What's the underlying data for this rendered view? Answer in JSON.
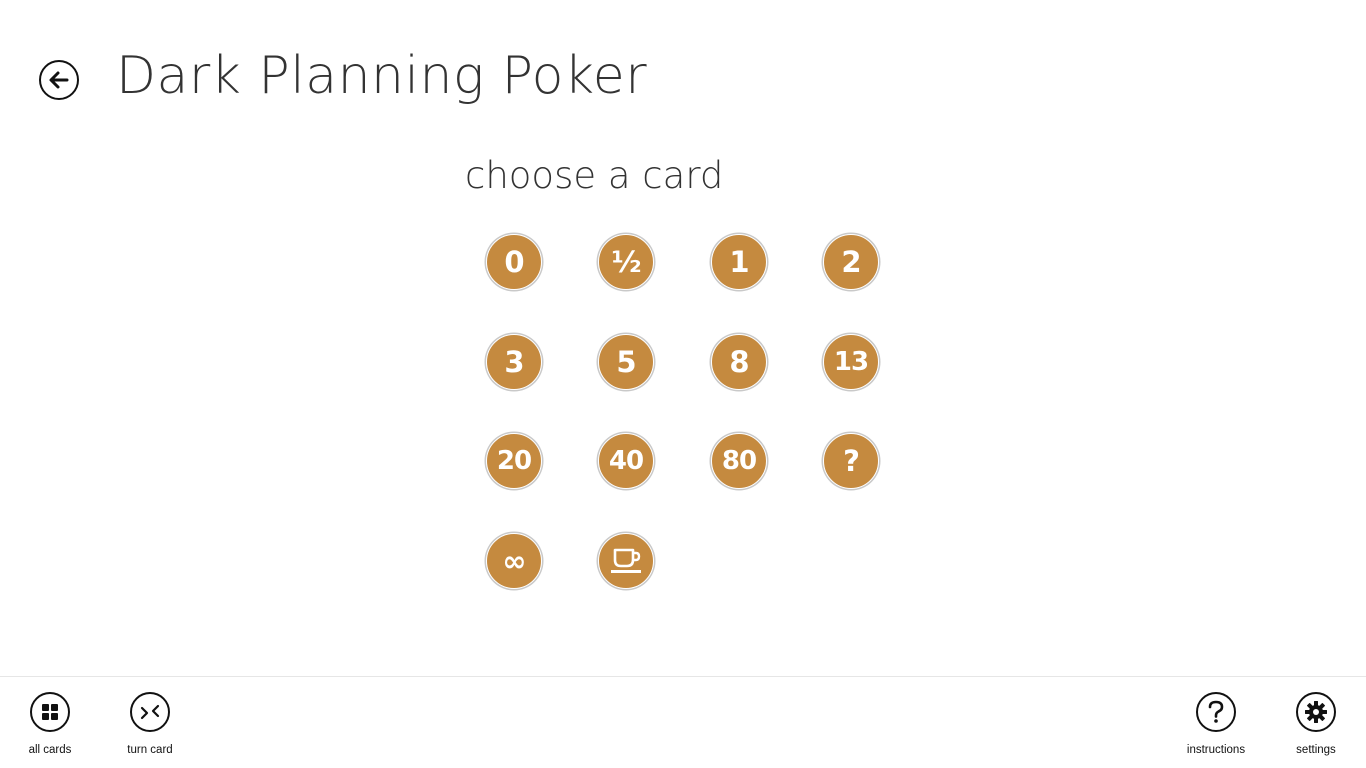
{
  "header": {
    "title": "Dark Planning Poker",
    "back_icon": "back-arrow-icon"
  },
  "main": {
    "subtitle": "choose a card",
    "card_color": "#c58a3f",
    "cards": [
      {
        "label": "0"
      },
      {
        "label": "½"
      },
      {
        "label": "1"
      },
      {
        "label": "2"
      },
      {
        "label": "3"
      },
      {
        "label": "5"
      },
      {
        "label": "8"
      },
      {
        "label": "13"
      },
      {
        "label": "20"
      },
      {
        "label": "40"
      },
      {
        "label": "80"
      },
      {
        "label": "?"
      },
      {
        "label": "∞"
      },
      {
        "label": "",
        "icon": "coffee-cup-icon"
      }
    ]
  },
  "app_bar": {
    "all_cards": {
      "label": "all cards",
      "icon": "grid-icon"
    },
    "turn_card": {
      "label": "turn card",
      "icon": "turn-card-icon"
    },
    "instructions": {
      "label": "instructions",
      "icon": "question-icon"
    },
    "settings": {
      "label": "settings",
      "icon": "gear-icon"
    }
  }
}
